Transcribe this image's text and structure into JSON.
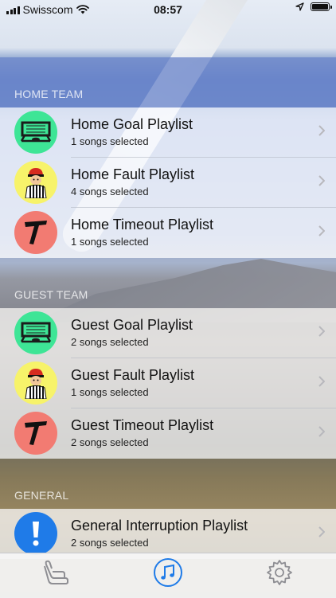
{
  "status_bar": {
    "carrier": "Swisscom",
    "time": "08:57"
  },
  "sections": {
    "home": {
      "label": "HOME TEAM"
    },
    "guest": {
      "label": "GUEST TEAM"
    },
    "general": {
      "label": "GENERAL"
    }
  },
  "rows": {
    "home_goal": {
      "title": "Home Goal Playlist",
      "subtitle": "1 songs selected",
      "icon": "hockey-goal-icon",
      "color": "#3ee596"
    },
    "home_fault": {
      "title": "Home Fault Playlist",
      "subtitle": "4 songs selected",
      "icon": "referee-icon",
      "color": "#f7f36a"
    },
    "home_timeout": {
      "title": "Home Timeout Playlist",
      "subtitle": "1 songs selected",
      "icon": "timeout-icon",
      "color": "#f27b72"
    },
    "guest_goal": {
      "title": "Guest Goal Playlist",
      "subtitle": "2 songs selected",
      "icon": "hockey-goal-icon",
      "color": "#3ee596"
    },
    "guest_fault": {
      "title": "Guest Fault Playlist",
      "subtitle": "1 songs selected",
      "icon": "referee-icon",
      "color": "#f7f36a"
    },
    "guest_timeout": {
      "title": "Guest Timeout Playlist",
      "subtitle": "2 songs selected",
      "icon": "timeout-icon",
      "color": "#f27b72"
    },
    "general_interruption": {
      "title": "General Interruption Playlist",
      "subtitle": "2 songs selected",
      "icon": "exclamation-icon",
      "color": "#1f7be8"
    }
  },
  "tabbar": {
    "items": [
      {
        "icon": "seat-icon",
        "selected": false
      },
      {
        "icon": "music-note-icon",
        "selected": true
      },
      {
        "icon": "gear-icon",
        "selected": false
      }
    ],
    "accent": "#1f7be8"
  }
}
